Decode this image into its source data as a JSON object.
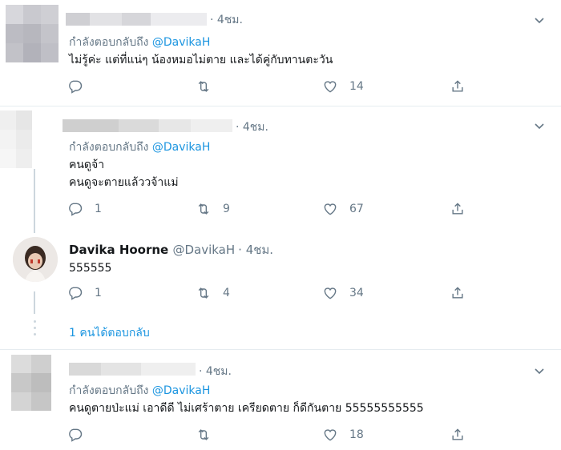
{
  "tweets": [
    {
      "time": "· 4ชม.",
      "replying_label": "กำลังตอบกลับถึง",
      "replying_handle": "@DavikaH",
      "text": "ไม่รู้ค่ะ แต่ที่แน่ๆ น้องหมอไม่ตาย และได้คู่กับทานตะวัน",
      "replies": "",
      "retweets": "",
      "likes": "14"
    },
    {
      "time": "· 4ชม.",
      "replying_label": "กำลังตอบกลับถึง",
      "replying_handle": "@DavikaH",
      "text": "คนดูจ้า\nคนดูจะตายแล้ววจ้าแม่",
      "replies": "1",
      "retweets": "9",
      "likes": "67"
    },
    {
      "name": "Davika Hoorne",
      "handle": "@DavikaH",
      "time": "· 4ชม.",
      "text": "555555",
      "replies": "1",
      "retweets": "4",
      "likes": "34"
    },
    {
      "time": "· 4ชม.",
      "replying_label": "กำลังตอบกลับถึง",
      "replying_handle": "@DavikaH",
      "text": "คนดูตายป่ะแม่ เอาดีดี ไม่เศร้าตาย เครียดตาย ก็ดีกันตาย 55555555555",
      "replies": "",
      "retweets": "",
      "likes": "18"
    }
  ],
  "show_replies": "1 คนได้ตอบกลับ",
  "colors": {
    "link": "#1b95e0",
    "muted": "#657786",
    "separator": "#e6ecf0"
  }
}
